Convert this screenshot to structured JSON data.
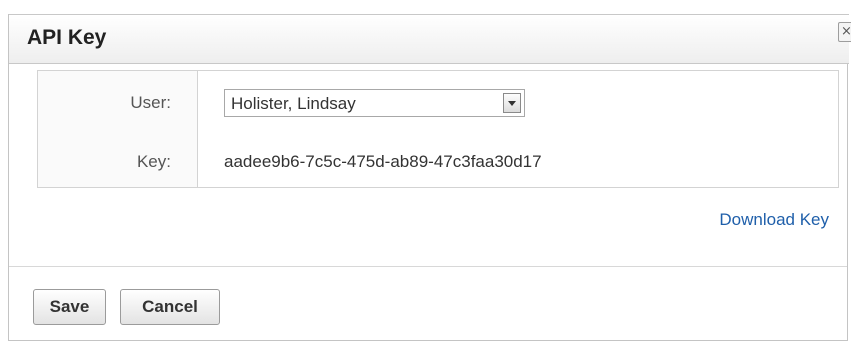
{
  "dialog": {
    "title": "API Key",
    "close_glyph": "×",
    "close_icon": "close-icon"
  },
  "form": {
    "user_label": "User:",
    "user_selected": "Holister, Lindsay",
    "key_label": "Key:",
    "key_value": "aadee9b6-7c5c-475d-ab89-47c3faa30d17"
  },
  "links": {
    "download_key": "Download Key"
  },
  "footer": {
    "save_label": "Save",
    "cancel_label": "Cancel"
  },
  "colors": {
    "link": "#1f5faa",
    "border": "#d3d3d3"
  }
}
